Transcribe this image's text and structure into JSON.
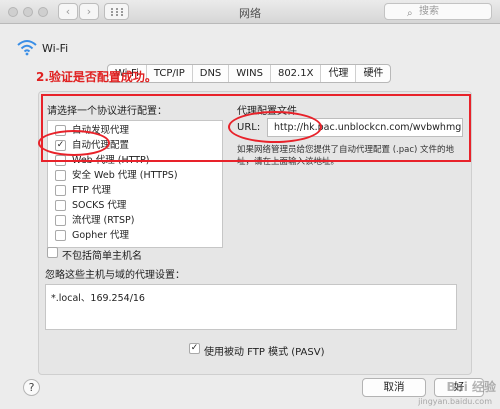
{
  "window": {
    "title": "网络",
    "search_placeholder": "搜索"
  },
  "header": {
    "label": "Wi-Fi"
  },
  "tabs": [
    {
      "label": "Wi-Fi"
    },
    {
      "label": "TCP/IP"
    },
    {
      "label": "DNS"
    },
    {
      "label": "WINS"
    },
    {
      "label": "802.1X"
    },
    {
      "label": "代理"
    },
    {
      "label": "硬件"
    }
  ],
  "annotation": "2.验证是否配置成功。",
  "panel": {
    "protocol_title": "请选择一个协议进行配置：",
    "proxy_file_title": "代理配置文件",
    "protocols": [
      {
        "label": "自动发现代理",
        "checked": false
      },
      {
        "label": "自动代理配置",
        "checked": true
      },
      {
        "label": "Web 代理 (HTTP)",
        "checked": false
      },
      {
        "label": "安全 Web 代理 (HTTPS)",
        "checked": false
      },
      {
        "label": "FTP 代理",
        "checked": false
      },
      {
        "label": "SOCKS 代理",
        "checked": false
      },
      {
        "label": "流代理 (RTSP)",
        "checked": false
      },
      {
        "label": "Gopher 代理",
        "checked": false
      }
    ],
    "url_label": "URL:",
    "url_value": "http://hk.pac.unblockcn.com/wvbwhmg",
    "help_text": "如果网络管理员给您提供了自动代理配置 (.pac) 文件的地址，请在上面输入该地址。",
    "exclude_simple_label": "不包括简单主机名",
    "exclude_simple_checked": false,
    "bypass_title": "忽略这些主机与域的代理设置：",
    "bypass_value": "*.local、169.254/16",
    "pasv_label": "使用被动 FTP 模式 (PASV)",
    "pasv_checked": true
  },
  "buttons": {
    "help": "?",
    "cancel": "取消",
    "ok": "好"
  },
  "watermark": {
    "brand": "Bai 经验",
    "url": "jingyan.baidu.com"
  },
  "colors": {
    "annotation_red": "#e8222a"
  }
}
